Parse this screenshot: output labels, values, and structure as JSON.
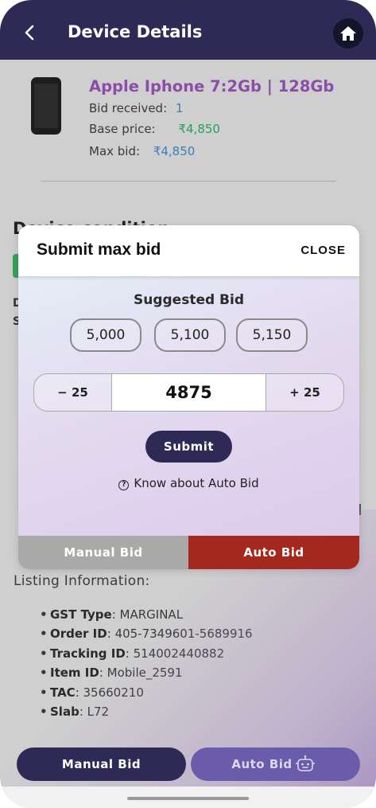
{
  "header": {
    "title": "Device Details",
    "back_icon": "chevron-left-icon",
    "home_icon": "home-icon"
  },
  "device": {
    "name": "Apple Iphone 7:2Gb | 128Gb",
    "bid_received_label": "Bid received:",
    "bid_received_value": "1",
    "base_price_label": "Base price:",
    "base_price_value": "₹4,850",
    "max_bid_label": "Max bid:",
    "max_bid_value": "₹4,850"
  },
  "background_partial": {
    "condition_heading": "Device condition",
    "d_letter": "D",
    "s_letter": "S"
  },
  "modal": {
    "title": "Submit max bid",
    "close_label": "CLOSE",
    "suggested_title": "Suggested Bid",
    "suggestions": [
      "5,000",
      "5,100",
      "5,150"
    ],
    "stepper_minus": "− 25",
    "stepper_value": "4875",
    "stepper_plus": "+ 25",
    "submit_label": "Submit",
    "help_icon": "question-circle-icon",
    "know_label": "Know about Auto Bid",
    "tab_manual": "Manual Bid",
    "tab_auto": "Auto Bid"
  },
  "listing": {
    "title": "Listing Information:",
    "items": [
      {
        "label": "GST Type",
        "value": ": MARGINAL"
      },
      {
        "label": "Order ID",
        "value": ": 405-7349601-5689916"
      },
      {
        "label": "Tracking ID",
        "value": ": 514002440882"
      },
      {
        "label": "Item ID",
        "value": ": Mobile_2591"
      },
      {
        "label": "TAC",
        "value": ": 35660210"
      },
      {
        "label": "Slab",
        "value": ": L72"
      }
    ]
  },
  "bottom": {
    "manual_label": "Manual Bid",
    "auto_label": "Auto Bid",
    "auto_icon": "robot-icon"
  },
  "colors": {
    "header_bg": "#2e2a55",
    "device_name": "#8a4da8",
    "auto_tab": "#a5281e",
    "green_price": "#25a05a",
    "blue_value": "#3b7fb8"
  }
}
